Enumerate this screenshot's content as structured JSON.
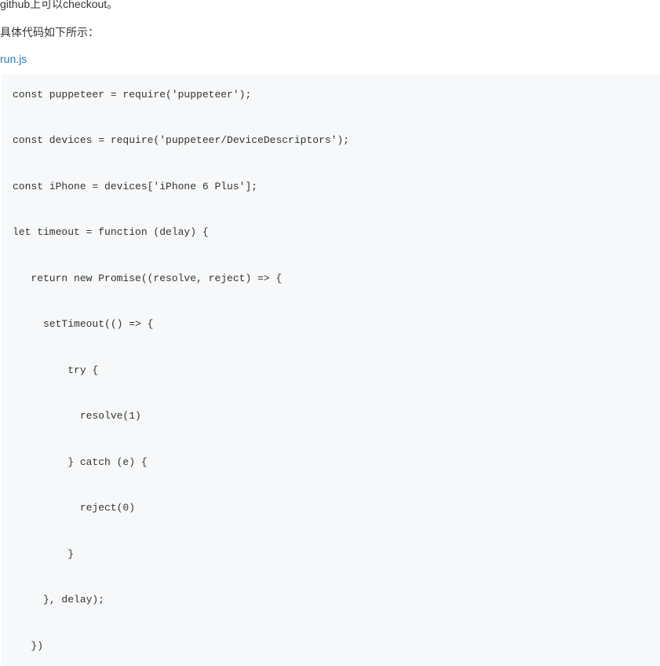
{
  "intro": {
    "line1": "github上可以checkout。",
    "line2": "具体代码如下所示：",
    "filename": "run.js"
  },
  "code": {
    "content": "const puppeteer = require('puppeteer');\n\n\nconst devices = require('puppeteer/DeviceDescriptors');\n\n\nconst iPhone = devices['iPhone 6 Plus'];\n\n\nlet timeout = function (delay) {\n\n\n   return new Promise((resolve, reject) => {\n\n\n     setTimeout(() => {\n\n\n         try {\n\n\n           resolve(1)\n\n\n         } catch (e) {\n\n\n           reject(0)\n\n\n         }\n\n\n     }, delay);\n\n\n   })"
  }
}
